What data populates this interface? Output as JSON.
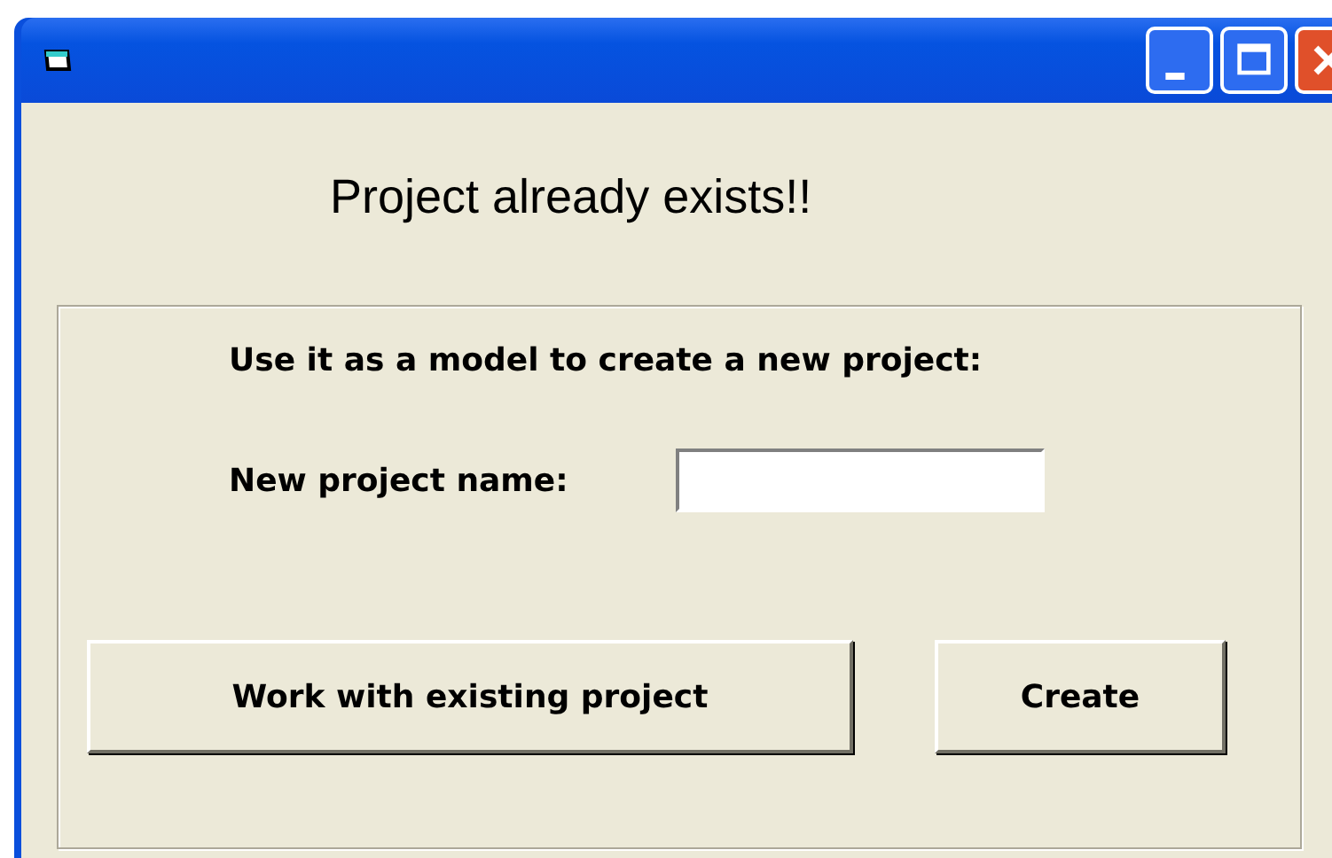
{
  "heading": "Project already exists!!",
  "group": {
    "instruction": "Use it as a model to create a new project:",
    "name_label": "New project name:"
  },
  "buttons": [
    {
      "label": "Work with existing project",
      "kind": "wide"
    },
    {
      "label": "Create",
      "kind": "narrow"
    }
  ]
}
